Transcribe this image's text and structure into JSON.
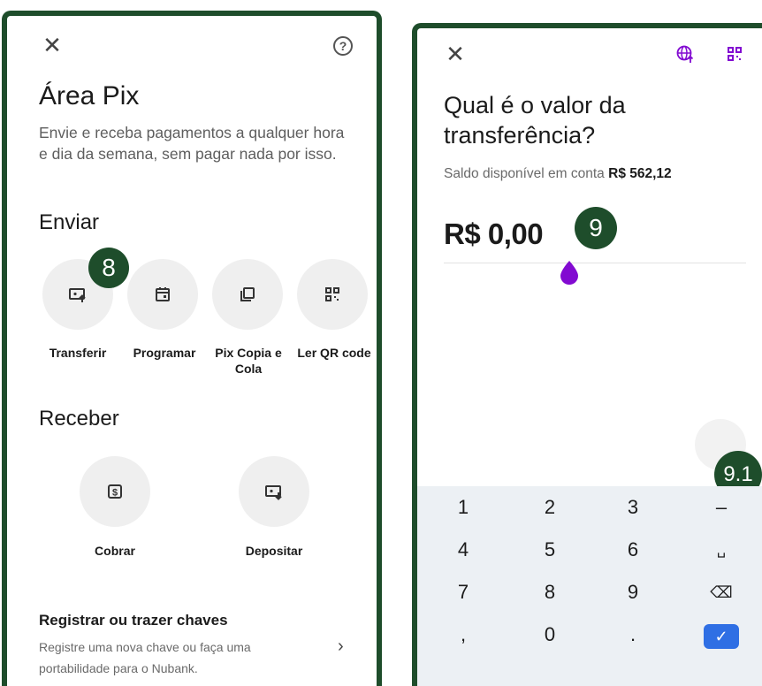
{
  "left_screen": {
    "title": "Área Pix",
    "description": "Envie e receba pagamentos a qualquer hora e dia da semana, sem pagar nada por isso.",
    "send_section": "Enviar",
    "send_actions": [
      {
        "label": "Transferir",
        "icon": "transfer-icon"
      },
      {
        "label": "Programar",
        "icon": "calendar-icon"
      },
      {
        "label": "Pix Copia e Cola",
        "icon": "copy-icon"
      },
      {
        "label": "Ler QR code",
        "icon": "qr-code-icon"
      }
    ],
    "receive_section": "Receber",
    "receive_actions": [
      {
        "label": "Cobrar",
        "icon": "charge-icon"
      },
      {
        "label": "Depositar",
        "icon": "deposit-icon"
      }
    ],
    "keys_title": "Registrar ou trazer chaves",
    "keys_description": "Registre uma nova chave ou faça uma portabilidade para o Nubank.",
    "step_badge": "8"
  },
  "right_screen": {
    "question": "Qual é o valor da transferência?",
    "balance_label": "Saldo disponível em conta",
    "balance_value": "R$ 562,12",
    "amount": "R$ 0,00",
    "step_badge": "9",
    "step_badge_2": "9.1",
    "keypad": [
      [
        "1",
        "2",
        "3",
        "–"
      ],
      [
        "4",
        "5",
        "6",
        "␣"
      ],
      [
        "7",
        "8",
        "9",
        "⌫"
      ],
      [
        ",",
        "0",
        ".",
        "✓"
      ]
    ]
  },
  "colors": {
    "frame": "#1e4d2b",
    "accent_purple": "#820ad1",
    "confirm_blue": "#2f6fe4"
  }
}
